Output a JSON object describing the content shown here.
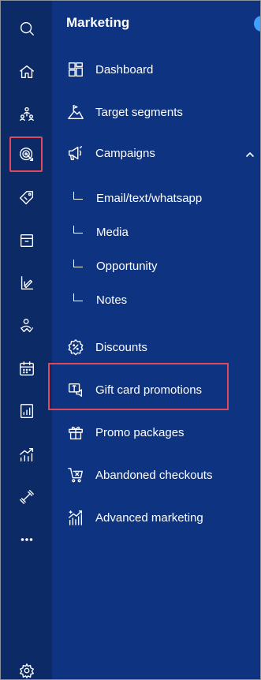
{
  "rail": {
    "items": [
      {
        "icon": "search-icon"
      },
      {
        "icon": "home-icon"
      },
      {
        "icon": "customers-icon"
      },
      {
        "icon": "marketing-target-icon"
      },
      {
        "icon": "tag-icon"
      },
      {
        "icon": "box-icon"
      },
      {
        "icon": "design-icon"
      },
      {
        "icon": "staff-icon"
      },
      {
        "icon": "calendar-icon"
      },
      {
        "icon": "report-icon"
      },
      {
        "icon": "analytics-icon"
      },
      {
        "icon": "fitness-icon"
      },
      {
        "icon": "more-icon"
      },
      {
        "icon": "settings-icon"
      }
    ],
    "active_index": 3
  },
  "panel": {
    "title": "Marketing",
    "items": [
      {
        "label": "Dashboard",
        "icon": "dashboard-icon"
      },
      {
        "label": "Target segments",
        "icon": "target-segments-icon"
      },
      {
        "label": "Campaigns",
        "icon": "megaphone-icon",
        "expanded": true
      },
      {
        "label": "Discounts",
        "icon": "discount-icon"
      },
      {
        "label": "Gift card promotions",
        "icon": "gift-card-icon",
        "highlighted": true
      },
      {
        "label": "Promo packages",
        "icon": "gift-box-icon"
      },
      {
        "label": "Abandoned checkouts",
        "icon": "cart-icon"
      },
      {
        "label": "Advanced marketing",
        "icon": "advanced-chart-icon"
      }
    ],
    "sub_items": [
      {
        "label": "Email/text/whatsapp"
      },
      {
        "label": "Media"
      },
      {
        "label": "Opportunity"
      },
      {
        "label": "Notes"
      }
    ]
  },
  "colors": {
    "rail_bg": "#0b2a66",
    "panel_bg": "#0e3381",
    "highlight": "#e0485b",
    "accent": "#3fa1ff"
  }
}
